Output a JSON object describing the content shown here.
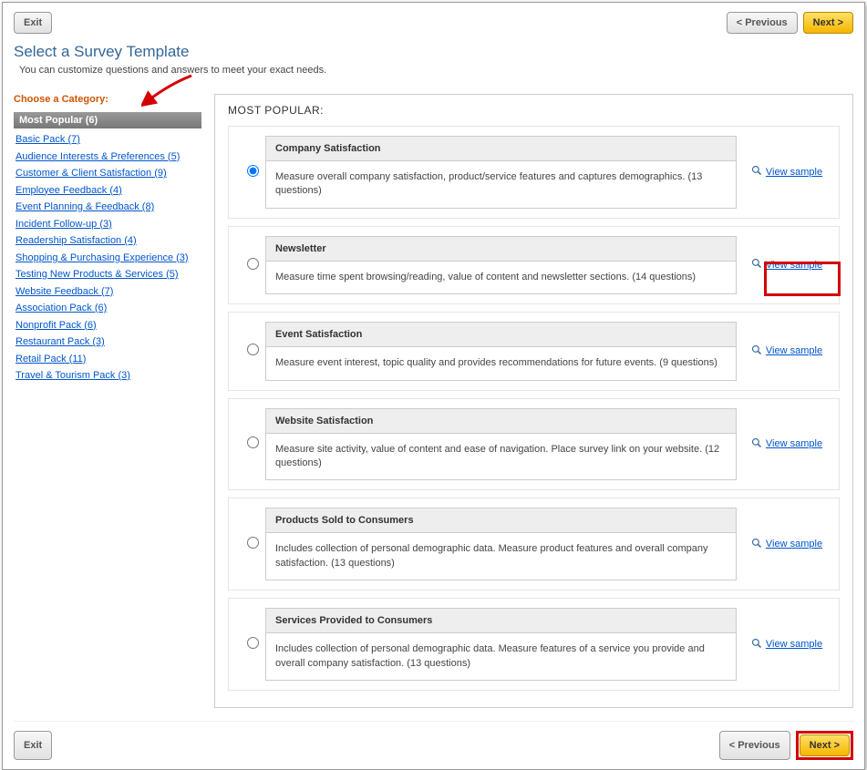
{
  "buttons": {
    "exit": "Exit",
    "previous": "< Previous",
    "next": "Next >"
  },
  "header": {
    "title": "Select a Survey Template",
    "subtitle": "You can customize questions and answers to meet your exact needs."
  },
  "sidebar": {
    "heading": "Choose a Category:",
    "active": "Most Popular (6)",
    "items": [
      "Basic Pack (7)",
      "Audience Interests & Preferences (5)",
      "Customer & Client Satisfaction (9)",
      "Employee Feedback (4)",
      "Event Planning & Feedback (8)",
      "Incident Follow-up (3)",
      "Readership Satisfaction (4)",
      "Shopping & Purchasing Experience (3)",
      "Testing New Products & Services (5)",
      "Website Feedback (7)",
      "Association Pack (6)",
      "Nonprofit Pack (6)",
      "Restaurant Pack (3)",
      "Retail Pack (11)",
      "Travel & Tourism Pack (3)"
    ]
  },
  "templates": {
    "heading": "MOST POPULAR:",
    "view_sample": "View sample",
    "items": [
      {
        "title": "Company Satisfaction",
        "desc": "Measure overall company satisfaction, product/service features and captures demographics. (13 questions)"
      },
      {
        "title": "Newsletter",
        "desc": "Measure time spent browsing/reading, value of content and newsletter sections. (14 questions)"
      },
      {
        "title": "Event Satisfaction",
        "desc": "Measure event interest, topic quality and provides recommendations for future events. (9 questions)"
      },
      {
        "title": "Website Satisfaction",
        "desc": "Measure site activity, value of content and ease of navigation. Place survey link on your website. (12 questions)"
      },
      {
        "title": "Products Sold to Consumers",
        "desc": "Includes collection of personal demographic data. Measure product features and overall company satisfaction. (13 questions)"
      },
      {
        "title": "Services Provided to Consumers",
        "desc": "Includes collection of personal demographic data. Measure features of a service you provide and overall company satisfaction. (13 questions)"
      }
    ]
  }
}
